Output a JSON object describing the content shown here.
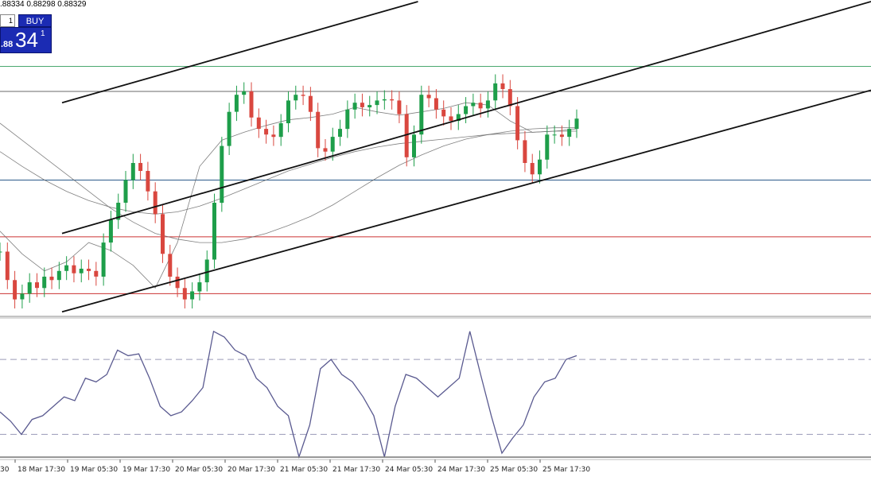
{
  "ohlc_readout": ".88334 0.88298 0.88329",
  "trade_panel": {
    "spin_value": "1",
    "buy_label": "BUY",
    "price_small": ".88",
    "price_big": "34",
    "price_sup": "1"
  },
  "colors": {
    "resistance_green": "#4aa870",
    "support_blue": "#2a5a8a",
    "support_red": "#cc3333",
    "candle_up": "#1e9e4a",
    "candle_down": "#d9473f",
    "ma_line": "#6a6a6a",
    "oscillator_line": "#5a5a90",
    "level_dashed": "#9a9ab8"
  },
  "chart_data": {
    "type": "line",
    "x_tick_labels": [
      "18 Mar 17:30",
      "19 Mar 05:30",
      "19 Mar 17:30",
      "20 Mar 05:30",
      "20 Mar 17:30",
      "21 Mar 05:30",
      "21 Mar 17:30",
      "24 Mar 05:30",
      "24 Mar 17:30",
      "25 Mar 05:30",
      "25 Mar 17:30"
    ],
    "x_tick_partial": "30",
    "price_series": [
      0.8737,
      0.8712,
      0.8695,
      0.87,
      0.871,
      0.8705,
      0.8715,
      0.8712,
      0.872,
      0.8725,
      0.8718,
      0.8722,
      0.872,
      0.8715,
      0.8745,
      0.8765,
      0.878,
      0.88,
      0.8815,
      0.8808,
      0.879,
      0.877,
      0.8735,
      0.8715,
      0.8705,
      0.8695,
      0.8702,
      0.871,
      0.873,
      0.878,
      0.883,
      0.886,
      0.8875,
      0.8878,
      0.8855,
      0.8845,
      0.884,
      0.8838,
      0.885,
      0.887,
      0.8875,
      0.8874,
      0.886,
      0.8828,
      0.8825,
      0.8838,
      0.8845,
      0.8862,
      0.8868,
      0.8864,
      0.8866,
      0.887,
      0.8871,
      0.887,
      0.8858,
      0.882,
      0.884,
      0.8875,
      0.8872,
      0.8862,
      0.8856,
      0.8852,
      0.8858,
      0.8865,
      0.8868,
      0.8863,
      0.887,
      0.8885,
      0.888,
      0.8865,
      0.8835,
      0.8815,
      0.8805,
      0.8818,
      0.884,
      0.884,
      0.8838,
      0.8845,
      0.8854
    ],
    "moving_averages": [
      [
        0.885,
        0.8835,
        0.882,
        0.8805,
        0.879,
        0.8775,
        0.8763,
        0.8753,
        0.8748,
        0.8745,
        0.8745,
        0.8748,
        0.8753,
        0.876,
        0.8768,
        0.8778,
        0.879,
        0.8802,
        0.8813,
        0.8822,
        0.883,
        0.8836,
        0.884,
        0.8843,
        0.8845,
        0.8846,
        0.8846
      ],
      [
        0.8825,
        0.8812,
        0.88,
        0.879,
        0.8782,
        0.8776,
        0.8772,
        0.877,
        0.8772,
        0.8777,
        0.8784,
        0.8792,
        0.88,
        0.8808,
        0.8814,
        0.882,
        0.8825,
        0.8829,
        0.8832,
        0.8834,
        0.8836,
        0.8838,
        0.884,
        0.8841,
        0.8842,
        0.8843,
        0.8843
      ],
      [
        0.8755,
        0.8735,
        0.872,
        0.8728,
        0.8745,
        0.8738,
        0.8725,
        0.8705,
        0.8745,
        0.8812,
        0.8835,
        0.8842,
        0.8848,
        0.8853,
        0.8855,
        0.8858,
        0.8864,
        0.886,
        0.8857,
        0.886,
        0.8863,
        0.8868,
        0.8866,
        0.8852,
        0.8842,
        0.8843,
        0.8845
      ]
    ],
    "horizontal_levels": [
      {
        "price": 0.89,
        "color": "resistance_green"
      },
      {
        "price": 0.8878,
        "color": "ma_line"
      },
      {
        "price": 0.88,
        "color": "support_blue"
      },
      {
        "price": 0.875,
        "color": "support_red"
      },
      {
        "price": 0.87,
        "color": "support_red"
      }
    ],
    "channel_lines": [
      {
        "from": [
          0,
          0.8868
        ],
        "to": [
          44,
          0.8957
        ]
      },
      {
        "from": [
          0,
          0.8753
        ],
        "to": [
          100,
          0.8957
        ]
      },
      {
        "from": [
          0,
          0.8684
        ],
        "to": [
          100,
          0.8879
        ]
      }
    ],
    "price_range": [
      0.868,
      0.8957
    ],
    "oscillator_series": [
      42,
      37,
      30,
      38,
      40,
      45,
      50,
      48,
      60,
      58,
      62,
      75,
      72,
      73,
      60,
      45,
      40,
      42,
      48,
      55,
      85,
      82,
      75,
      72,
      60,
      55,
      45,
      40,
      18,
      35,
      65,
      70,
      62,
      58,
      50,
      40,
      18,
      45,
      62,
      60,
      55,
      50,
      55,
      60,
      85,
      62,
      40,
      20,
      28,
      35,
      50,
      58,
      60,
      70,
      72
    ],
    "oscillator_levels": [
      70,
      30
    ],
    "oscillator_range": [
      20,
      90
    ],
    "grid": false
  }
}
